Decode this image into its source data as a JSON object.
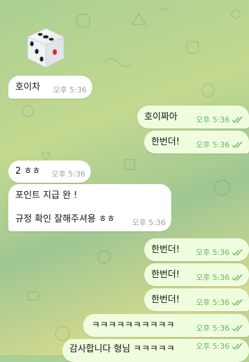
{
  "messages": [
    {
      "dir": "in",
      "text": "호이차",
      "time": "오후 5:36"
    },
    {
      "dir": "out",
      "text": "호이짜아",
      "time": "오후 5:36"
    },
    {
      "dir": "out",
      "text": "한번더!",
      "time": "오후 5:36"
    },
    {
      "dir": "in",
      "text": "2 ㅎㅎ",
      "time": "오후 5:36"
    },
    {
      "dir": "in",
      "text": "포인트 지급 완 !\n\n규정 확인 잘해주셔용 ㅎㅎ",
      "time": "오후 5:36"
    },
    {
      "dir": "out",
      "text": "한번더!",
      "time": "오후 5:36"
    },
    {
      "dir": "out",
      "text": "한번더!",
      "time": "오후 5:36"
    },
    {
      "dir": "out",
      "text": "한번더!",
      "time": "오후 5:36"
    },
    {
      "dir": "out",
      "text": "ㅋㅋㅋㅋㅋㅋㅋㅋㅋㅋ",
      "time": "오후 5:36"
    },
    {
      "dir": "out",
      "text": "감사합니다 형님 ㅋㅋㅋㅋㅋ",
      "time": "오후 5:36"
    }
  ],
  "dice": {
    "icon": "dice-icon"
  },
  "colors": {
    "incoming": "#ffffff",
    "outgoing": "#effdde",
    "time_out": "#6bb46a",
    "time_in": "#9aa59a"
  }
}
